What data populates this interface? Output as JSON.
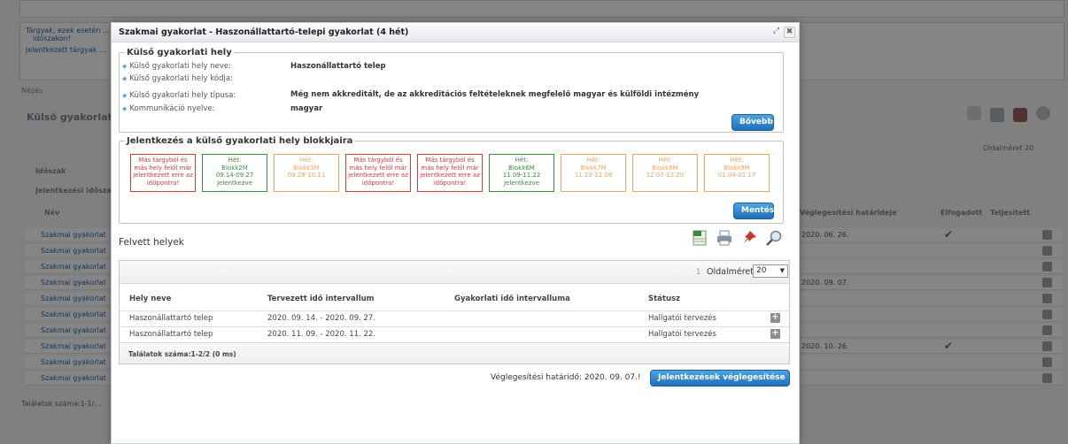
{
  "background": {
    "link1a": "Tárgyak, ezek esetén ...",
    "link1b": "időszakon!",
    "link2": "Jelentkezett tárgyak ...",
    "filter_label": "Nézés",
    "section_title": "Külső gyakorlati tá...",
    "page_size_text": "Oldalméret 20",
    "group1": "Időszak",
    "group2": "Jelentkezési időszakok",
    "col_name": "Név",
    "col_deadline": "Véglegesítési határideje",
    "col_accepted": "Elfogadott",
    "col_done": "Teljesített",
    "row_text": "Szakmai gyakorlat",
    "dates": [
      "2020. 06. 26.",
      "2020. 09. 07.",
      "2020. 10. 26."
    ],
    "footer": "Találatok száma:1-1/..."
  },
  "modal": {
    "title": "Szakmai gyakorlat - Haszonállattartó-telepi gyakorlat (4 hét)",
    "restore_icon": "restore-icon",
    "close_icon": "close-icon",
    "close_glyph": "✖",
    "restore_glyph": "⤢"
  },
  "external_place": {
    "legend": "Külső gyakorlati hely",
    "rows": [
      {
        "label": "Külső gyakorlati hely neve:",
        "value": "Haszonállattartó telep"
      },
      {
        "label": "Külső gyakorlati hely kódja:",
        "value": ""
      },
      {
        "label": "Külső gyakorlati hely típusa:",
        "value": "Még nem akkreditált, de az akkreditációs feltételeknek megfelelő magyar és külföldi intézmény"
      },
      {
        "label": "Kommunikáció nyelve:",
        "value": "magyar"
      }
    ],
    "more_button": "Bővebb"
  },
  "blocks_section": {
    "legend": "Jelentkezés a külső gyakorlati hely blokkjaira",
    "blocks": [
      {
        "status": "red",
        "l1": "Más tárgyból és",
        "l2": "más hely felől már",
        "l3": "jelentkezett erre az",
        "l4": "időpontra!"
      },
      {
        "status": "green",
        "l1": "Hét:",
        "l2": "Blokk2M",
        "l3": "09.14-09.27",
        "l4": "Jelentkezve"
      },
      {
        "status": "orange",
        "l1": "Hét:",
        "l2": "Blokk3M",
        "l3": "09.28-10.11",
        "l4": ""
      },
      {
        "status": "red",
        "l1": "Más tárgyból és",
        "l2": "más hely felől már",
        "l3": "jelentkezett erre az",
        "l4": "időpontra!"
      },
      {
        "status": "red",
        "l1": "Más tárgyból és",
        "l2": "más hely felől már",
        "l3": "jelentkezett erre az",
        "l4": "időpontra!"
      },
      {
        "status": "green",
        "l1": "Hét:",
        "l2": "Blokk6M",
        "l3": "11.09-11.22",
        "l4": "Jelentkezve"
      },
      {
        "status": "orange",
        "l1": "Hét:",
        "l2": "Blokk7M",
        "l3": "11.23-12.06",
        "l4": ""
      },
      {
        "status": "orange",
        "l1": "Hét:",
        "l2": "Blokk8M",
        "l3": "12.07-12.20",
        "l4": ""
      },
      {
        "status": "orange",
        "l1": "Hét:",
        "l2": "Blokk9M",
        "l3": "01.04-01.17",
        "l4": ""
      }
    ],
    "save_button": "Mentés"
  },
  "taken_places": {
    "title": "Felvett helyek",
    "tools": [
      "excel-export-icon",
      "print-icon",
      "pin-icon",
      "search-icon"
    ],
    "page_number": "1",
    "page_size_label": "Oldalméret",
    "page_size_value": "20",
    "columns": [
      "Hely neve",
      "Tervezett idő intervallum",
      "Gyakorlati idő intervalluma",
      "Státusz"
    ],
    "rows": [
      {
        "name": "Haszonállattartó telep",
        "planned": "2020. 09. 14. - 2020. 09. 27.",
        "actual": "",
        "status": "Hallgatói tervezés"
      },
      {
        "name": "Haszonállattartó telep",
        "planned": "2020. 11. 09. - 2020. 11. 22.",
        "actual": "",
        "status": "Hallgatói tervezés"
      }
    ],
    "footer": "Találatok száma:1-2/2 (0 ms)"
  },
  "finalize": {
    "deadline_text": "Véglegesítési határidő: 2020. 09. 07.!",
    "button": "Jelentkezések véglegesítése"
  },
  "colors": {
    "red": "#d43b3b",
    "green": "#3c8a3c",
    "orange": "#f0a35a",
    "accent": "#1f6fb8"
  }
}
